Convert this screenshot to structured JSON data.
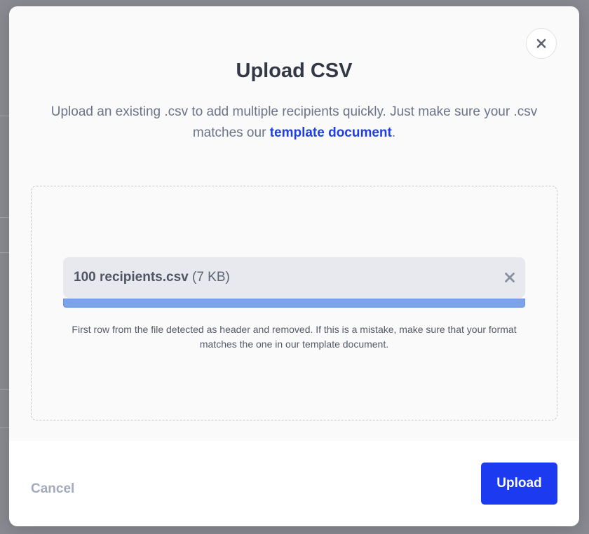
{
  "modal": {
    "title": "Upload CSV",
    "subtitle_text": "Upload an existing .csv to add multiple recipients quickly. Just make sure your .csv matches our ",
    "subtitle_link": "template document",
    "subtitle_end": ".",
    "close_icon": "close-icon"
  },
  "upload": {
    "file_name": "100 recipients.csv",
    "file_size": "(7 KB)",
    "remove_icon": "close-icon",
    "progress_fraction": 1.0,
    "note": "First row from the file detected as header and removed. If this is a mistake, make sure that your format matches the one in our template document."
  },
  "footer": {
    "cancel_label": "Cancel",
    "upload_label": "Upload"
  },
  "colors": {
    "accent": "#1c3bf0",
    "link": "#1f3ee8",
    "progress": "#7ba3ea"
  }
}
